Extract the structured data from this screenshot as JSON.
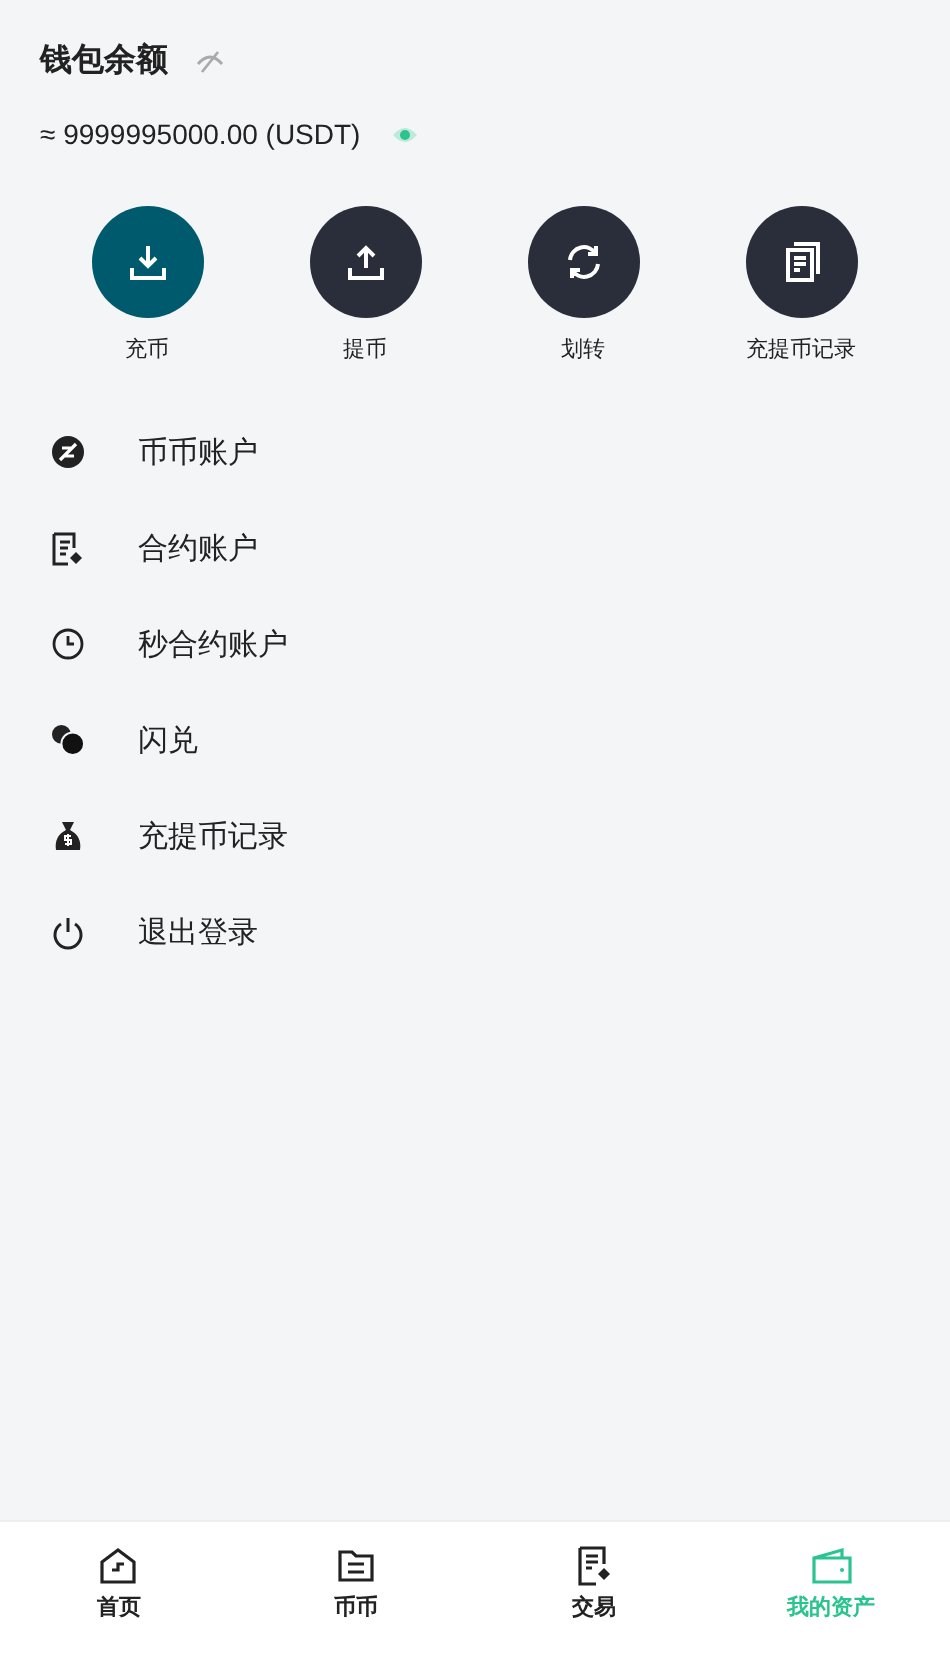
{
  "header": {
    "title": "钱包余额",
    "balance_hidden": false,
    "balance": "≈ 9999995000.00 (USDT)"
  },
  "actions": [
    {
      "label": "充币",
      "kind": "deposit",
      "selected": true
    },
    {
      "label": "提币",
      "kind": "withdraw",
      "selected": false
    },
    {
      "label": "划转",
      "kind": "transfer",
      "selected": false
    },
    {
      "label": "充提币记录",
      "kind": "records",
      "selected": false
    }
  ],
  "menu": [
    {
      "label": "币币账户",
      "kind": "spot"
    },
    {
      "label": "合约账户",
      "kind": "contract"
    },
    {
      "label": "秒合约账户",
      "kind": "clock"
    },
    {
      "label": "闪兑",
      "kind": "swap"
    },
    {
      "label": "充提币记录",
      "kind": "moneybag"
    },
    {
      "label": "退出登录",
      "kind": "logout"
    }
  ],
  "tabs": [
    {
      "label": "首页",
      "kind": "home",
      "selected": false
    },
    {
      "label": "币币",
      "kind": "spot",
      "selected": false
    },
    {
      "label": "交易",
      "kind": "trade",
      "selected": false
    },
    {
      "label": "我的资产",
      "kind": "wallet",
      "selected": true
    }
  ]
}
